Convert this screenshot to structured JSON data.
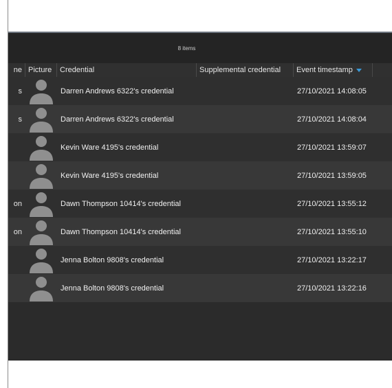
{
  "list": {
    "item_count": "8 items",
    "columns": {
      "name": "ne",
      "picture": "Picture",
      "credential": "Credential",
      "supplemental": "Supplemental credential",
      "timestamp": "Event timestamp"
    },
    "sort": {
      "column": "Event timestamp",
      "direction": "descending"
    },
    "rows": [
      {
        "name": "s",
        "credential": "Darren Andrews 6322's credential",
        "supplemental": "",
        "timestamp": "27/10/2021 14:08:05"
      },
      {
        "name": "s",
        "credential": "Darren Andrews 6322's credential",
        "supplemental": "",
        "timestamp": "27/10/2021 14:08:04"
      },
      {
        "name": "",
        "credential": "Kevin  Ware 4195's credential",
        "supplemental": "",
        "timestamp": "27/10/2021 13:59:07"
      },
      {
        "name": "",
        "credential": "Kevin  Ware 4195's credential",
        "supplemental": "",
        "timestamp": "27/10/2021 13:59:05"
      },
      {
        "name": "on",
        "credential": "Dawn  Thompson 10414's credential",
        "supplemental": "",
        "timestamp": "27/10/2021 13:55:12"
      },
      {
        "name": "on",
        "credential": "Dawn  Thompson 10414's credential",
        "supplemental": "",
        "timestamp": "27/10/2021 13:55:10"
      },
      {
        "name": "",
        "credential": "Jenna Bolton 9808's credential",
        "supplemental": "",
        "timestamp": "27/10/2021 13:22:17"
      },
      {
        "name": "",
        "credential": "Jenna Bolton 9808's credential",
        "supplemental": "",
        "timestamp": "27/10/2021 13:22:16"
      }
    ]
  },
  "icons": {
    "picture_placeholder": "user-silhouette-icon",
    "sort_indicator": "sort-descending-icon"
  },
  "colors": {
    "panel_bg": "#2b2b2b",
    "row_odd": "#2f2f2f",
    "row_even": "#383838",
    "accent": "#3a9ad9",
    "avatar": "#8f8f8f"
  }
}
